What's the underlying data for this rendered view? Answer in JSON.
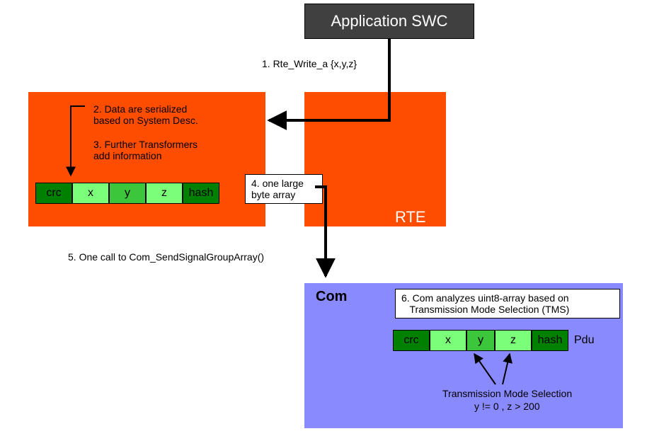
{
  "swc": {
    "label": "Application SWC"
  },
  "step1": "1. Rte_Write_a {x,y,z}",
  "step2": "2. Data are serialized\nbased on System Desc.",
  "step3": "3. Further Transformers\nadd information",
  "step4": "4. one large\nbyte array",
  "step5": "5. One call to Com_SendSignalGroupArray()",
  "step6": "6. Com analyzes uint8-array based on\n   Transmission Mode Selection (TMS)",
  "rte_label": "RTE",
  "com_label": "Com",
  "pdu_cells": {
    "crc": "crc",
    "x": "x",
    "y": "y",
    "z": "z",
    "hash": "hash"
  },
  "pdu_label": "Pdu",
  "tms_title": "Transmission Mode Selection",
  "tms_cond": "y != 0 , z > 200"
}
